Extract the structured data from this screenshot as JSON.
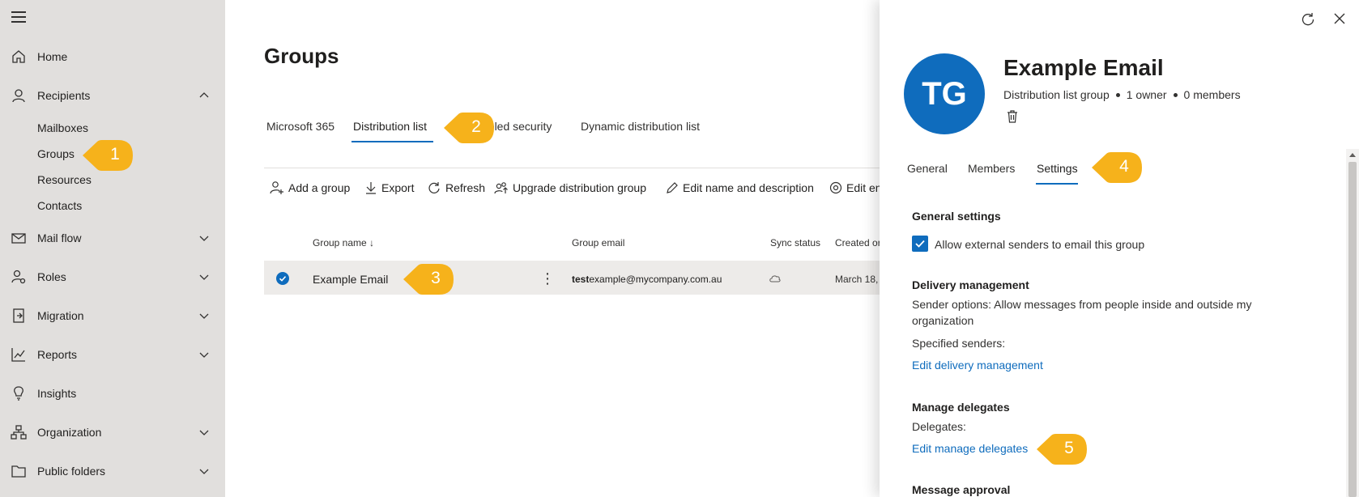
{
  "sidebar": {
    "menu_icon": "hamburger-icon",
    "items": [
      {
        "label": "Home",
        "icon": "home-icon"
      },
      {
        "label": "Recipients",
        "icon": "person-icon"
      },
      {
        "label": "Mail flow",
        "icon": "mail-icon"
      },
      {
        "label": "Roles",
        "icon": "roles-icon"
      },
      {
        "label": "Migration",
        "icon": "migration-icon"
      },
      {
        "label": "Reports",
        "icon": "chart-icon"
      },
      {
        "label": "Insights",
        "icon": "lightbulb-icon"
      },
      {
        "label": "Organization",
        "icon": "organization-icon"
      },
      {
        "label": "Public folders",
        "icon": "folder-icon"
      }
    ],
    "recipients_sub": [
      "Mailboxes",
      "Groups",
      "Resources",
      "Contacts"
    ]
  },
  "main": {
    "title": "Groups",
    "tabs": [
      "Microsoft 365",
      "Distribution list",
      "abled security",
      "Dynamic distribution list"
    ],
    "commands": [
      "Add a group",
      "Export",
      "Refresh",
      "Upgrade distribution group",
      "Edit name and description",
      "Edit en"
    ],
    "columns": [
      "Group name",
      "Group email",
      "Sync status",
      "Created or"
    ],
    "rows": [
      {
        "name": "Example Email",
        "email_bold": "test",
        "email_rest": "example@mycompany.com.au",
        "created": "March 18,"
      }
    ]
  },
  "panel": {
    "avatar_initials": "TG",
    "title": "Example Email",
    "meta": {
      "type": "Distribution list group",
      "owners": "1 owner",
      "members": "0 members"
    },
    "tabs": [
      "General",
      "Members",
      "Settings"
    ],
    "general_settings": {
      "heading": "General settings",
      "checkbox_label": "Allow external senders to email this group",
      "checked": true
    },
    "delivery": {
      "heading": "Delivery management",
      "sender_options_line1": "Sender options: Allow messages from people inside and outside my",
      "sender_options_line2": "organization",
      "specified": "Specified senders:",
      "link": "Edit delivery management"
    },
    "delegates": {
      "heading": "Manage delegates",
      "label": "Delegates:",
      "link": "Edit manage delegates"
    },
    "approval": {
      "heading": "Message approval"
    }
  },
  "callouts": [
    "1",
    "2",
    "3",
    "4",
    "5"
  ],
  "colors": {
    "accent": "#0f6cbd",
    "callout": "#f6b21b",
    "sidebar": "#e1dfdd"
  }
}
